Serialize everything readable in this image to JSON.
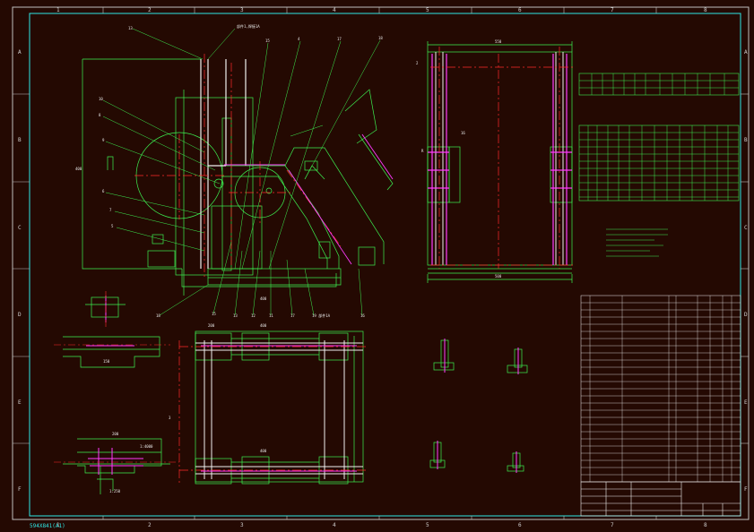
{
  "drawing": {
    "grid_columns": [
      "1",
      "2",
      "3",
      "4",
      "5",
      "6",
      "7",
      "8"
    ],
    "grid_rows": [
      "A",
      "B",
      "C",
      "D",
      "E",
      "F"
    ],
    "file_label": "594X841(A1)",
    "colors": {
      "background": "#240902",
      "border": "#2ee6e6",
      "outline": "#3cf050",
      "centerline": "#ff2a2a",
      "highlight": "#ff3cff",
      "dimension": "#f0f0f0",
      "annotation": "#e8e8e8"
    }
  }
}
